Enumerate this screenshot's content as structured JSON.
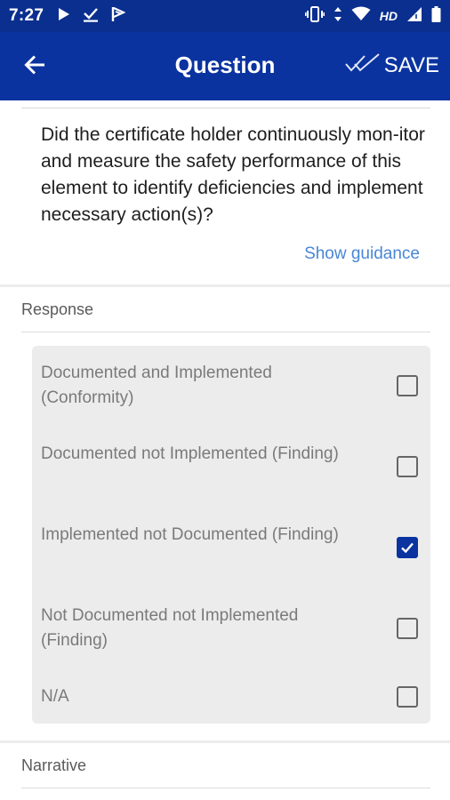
{
  "status_bar": {
    "time": "7:27",
    "hd_label": "HD",
    "left_icons": [
      "play-icon",
      "download-done-icon",
      "flag-icon"
    ],
    "right_icons": [
      "vibrate-icon",
      "data-arrows-icon",
      "wifi-icon",
      "signal-icon",
      "battery-icon"
    ]
  },
  "app_bar": {
    "title": "Question",
    "save_label": "SAVE",
    "background_color": "#0a33a0"
  },
  "question": {
    "text": "Did the certificate holder continuously mon-itor and measure the safety performance of this element to identify deficiencies and implement necessary action(s)?",
    "guidance_link": "Show guidance"
  },
  "response": {
    "label": "Response",
    "options": [
      {
        "label": "Documented and Implemented (Conformity)",
        "checked": false
      },
      {
        "label": "Documented not Implemented (Finding)",
        "checked": false
      },
      {
        "label": "Implemented not Documented (Finding)",
        "checked": true
      },
      {
        "label": "Not Documented not Implemented (Finding)",
        "checked": false
      },
      {
        "label": "N/A",
        "checked": false
      }
    ]
  },
  "narrative": {
    "label": "Narrative"
  },
  "colors": {
    "primary": "#0a33a0",
    "link": "#4a86d6",
    "card_bg": "#ececec"
  }
}
